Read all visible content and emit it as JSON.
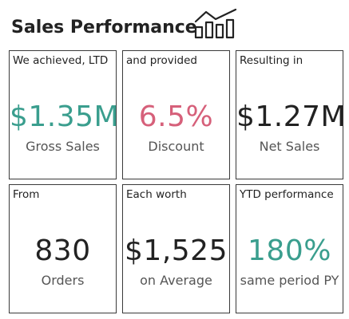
{
  "header": {
    "title": "Sales Performance",
    "icon": "bar-chart-trend-icon"
  },
  "colors": {
    "teal": "#3a9e8e",
    "rose": "#d6607a",
    "dark": "#222222",
    "caption": "#555555"
  },
  "cards": [
    {
      "label": "We achieved, LTD",
      "value": "$1.35M",
      "caption": "Gross Sales",
      "color": "#3a9e8e"
    },
    {
      "label": "and provided",
      "value": "6.5%",
      "caption": "Discount",
      "color": "#d6607a"
    },
    {
      "label": "Resulting in",
      "value": "$1.27M",
      "caption": "Net Sales",
      "color": "#222222"
    },
    {
      "label": "From",
      "value": "830",
      "caption": "Orders",
      "color": "#222222"
    },
    {
      "label": "Each worth",
      "value": "$1,525",
      "caption": "on Average",
      "color": "#222222"
    },
    {
      "label": "YTD performance",
      "value": "180%",
      "caption": "same period PY",
      "color": "#3a9e8e"
    }
  ]
}
